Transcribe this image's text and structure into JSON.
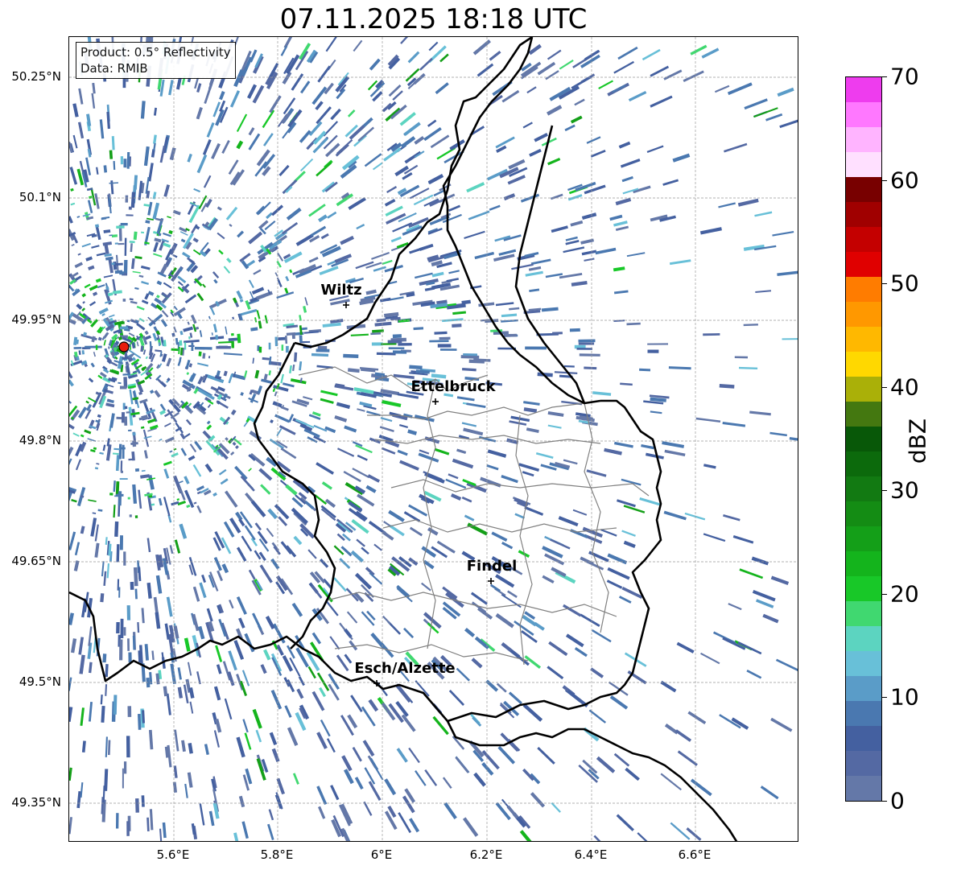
{
  "title": "07.11.2025 18:18 UTC",
  "info": {
    "product": "Product: 0.5° Reflectivity",
    "data": "Data: RMIB"
  },
  "lat_ticks": [
    "50.25°N",
    "50.1°N",
    "49.95°N",
    "49.8°N",
    "49.65°N",
    "49.5°N",
    "49.35°N"
  ],
  "lon_ticks": [
    "5.6°E",
    "5.8°E",
    "6°E",
    "6.2°E",
    "6.4°E",
    "6.6°E"
  ],
  "cities": [
    "Wiltz",
    "Ettelbruck",
    "Findel",
    "Esch/Alzette"
  ],
  "colorbar": {
    "label": "dBZ",
    "tick_labels": [
      "0",
      "10",
      "20",
      "30",
      "40",
      "50",
      "60",
      "70"
    ],
    "colors": [
      "#6478a8",
      "#5469a3",
      "#4460a0",
      "#4a78b0",
      "#5a9cc8",
      "#68c0d8",
      "#5cd4c0",
      "#40d870",
      "#18c828",
      "#14b41c",
      "#149f18",
      "#148c14",
      "#127a12",
      "#0c6a0c",
      "#085808",
      "#447810",
      "#aab008",
      "#ffd800",
      "#ffb800",
      "#ff9800",
      "#ff7c00",
      "#e00000",
      "#c40000",
      "#a00000",
      "#780000",
      "#ffe0ff",
      "#ffb4ff",
      "#ff78ff",
      "#ee3cee"
    ]
  },
  "radar_site_color": "#e81c0c"
}
